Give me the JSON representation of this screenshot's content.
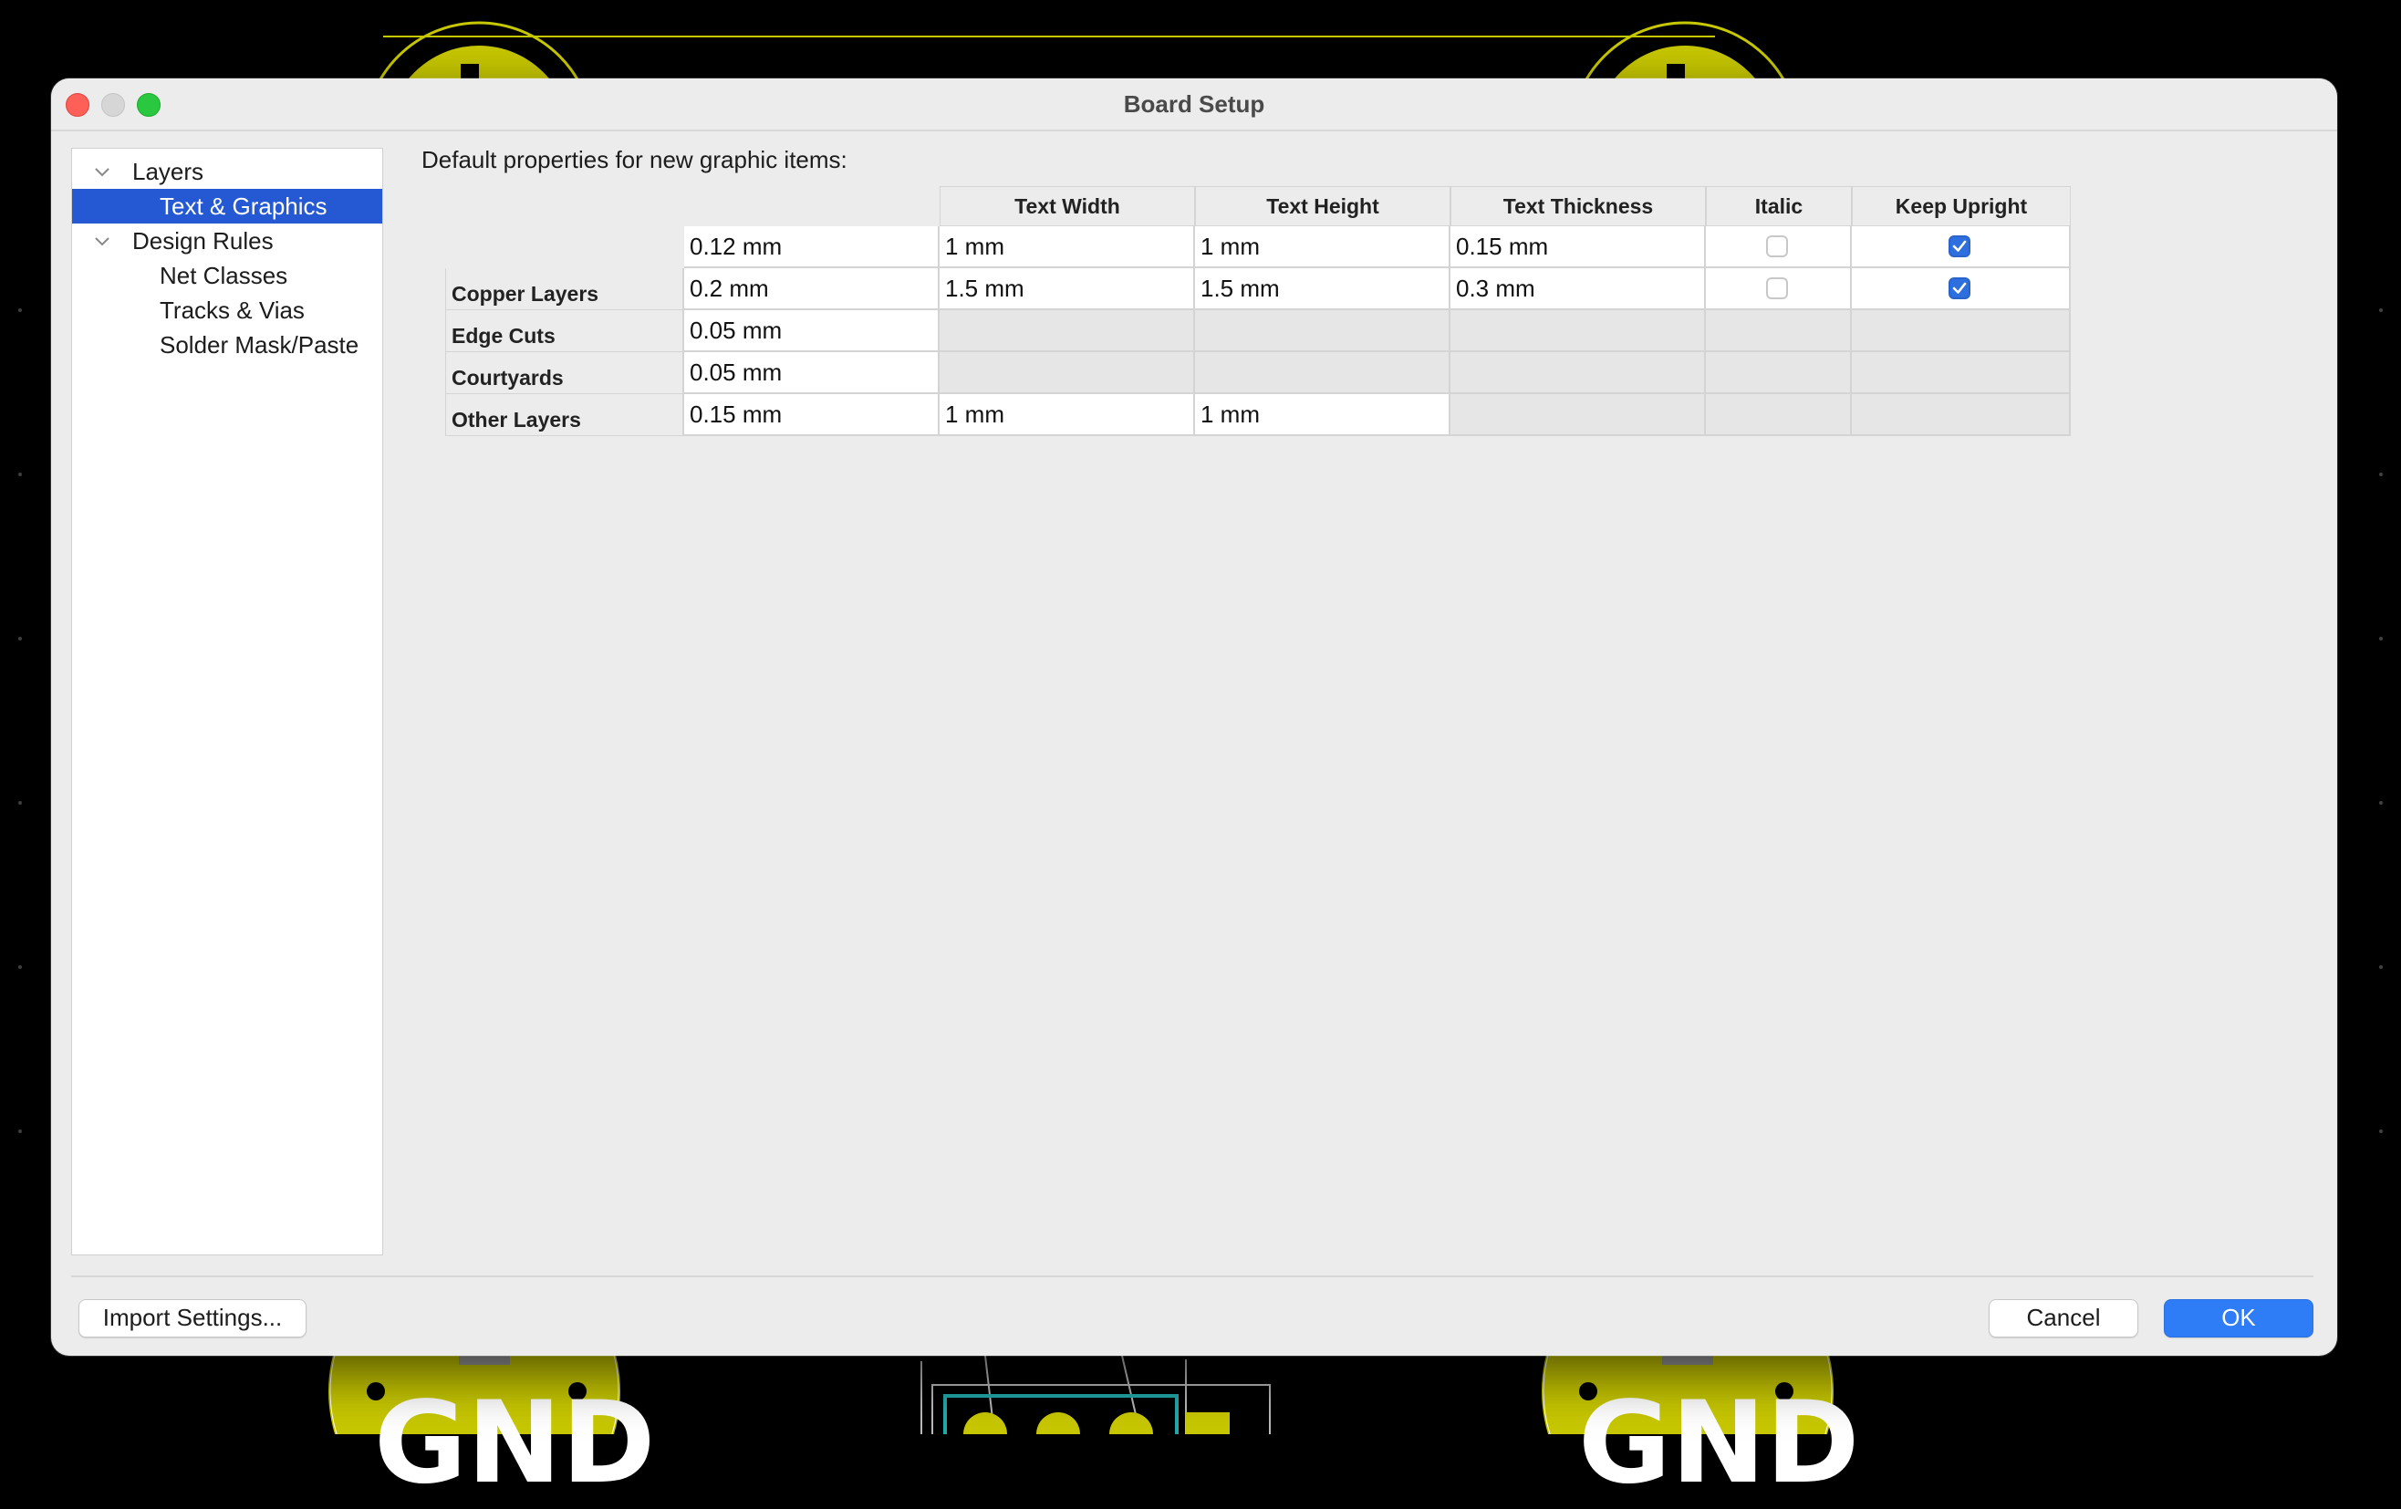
{
  "window": {
    "title": "Board Setup"
  },
  "background": {
    "pad_labels": [
      "GND",
      "GND"
    ]
  },
  "sidebar": {
    "items": [
      {
        "label": "Layers",
        "expanded": true,
        "level": 0
      },
      {
        "label": "Text & Graphics",
        "selected": true,
        "level": 1
      },
      {
        "label": "Design Rules",
        "expanded": true,
        "level": 0
      },
      {
        "label": "Net Classes",
        "level": 1
      },
      {
        "label": "Tracks & Vias",
        "level": 1
      },
      {
        "label": "Solder Mask/Paste",
        "level": 1
      }
    ]
  },
  "main": {
    "heading": "Default properties for new graphic items:",
    "columns": [
      "",
      "Text Width",
      "Text Height",
      "Text Thickness",
      "Italic",
      "Keep Upright"
    ],
    "rows": [
      {
        "label": "",
        "line_width": "0.12 mm",
        "text_width": "1 mm",
        "text_height": "1 mm",
        "text_thickness": "0.15 mm",
        "italic": false,
        "keep_upright": true
      },
      {
        "label": "Copper Layers",
        "line_width": "0.2 mm",
        "text_width": "1.5 mm",
        "text_height": "1.5 mm",
        "text_thickness": "0.3 mm",
        "italic": false,
        "keep_upright": true
      },
      {
        "label": "Edge Cuts",
        "line_width": "0.05 mm",
        "text_width": "",
        "text_height": "",
        "text_thickness": "",
        "italic": null,
        "keep_upright": null
      },
      {
        "label": "Courtyards",
        "line_width": "0.05 mm",
        "text_width": "",
        "text_height": "",
        "text_thickness": "",
        "italic": null,
        "keep_upright": null
      },
      {
        "label": "Other Layers",
        "line_width": "0.15 mm",
        "text_width": "1 mm",
        "text_height": "1 mm",
        "text_thickness": "",
        "italic": null,
        "keep_upright": null
      }
    ]
  },
  "footer": {
    "import_label": "Import Settings...",
    "cancel_label": "Cancel",
    "ok_label": "OK"
  },
  "colors": {
    "selection": "#2559d4",
    "primary_button": "#2f7df6",
    "pcb_pad": "#c8c800",
    "pcb_background": "#000000"
  }
}
